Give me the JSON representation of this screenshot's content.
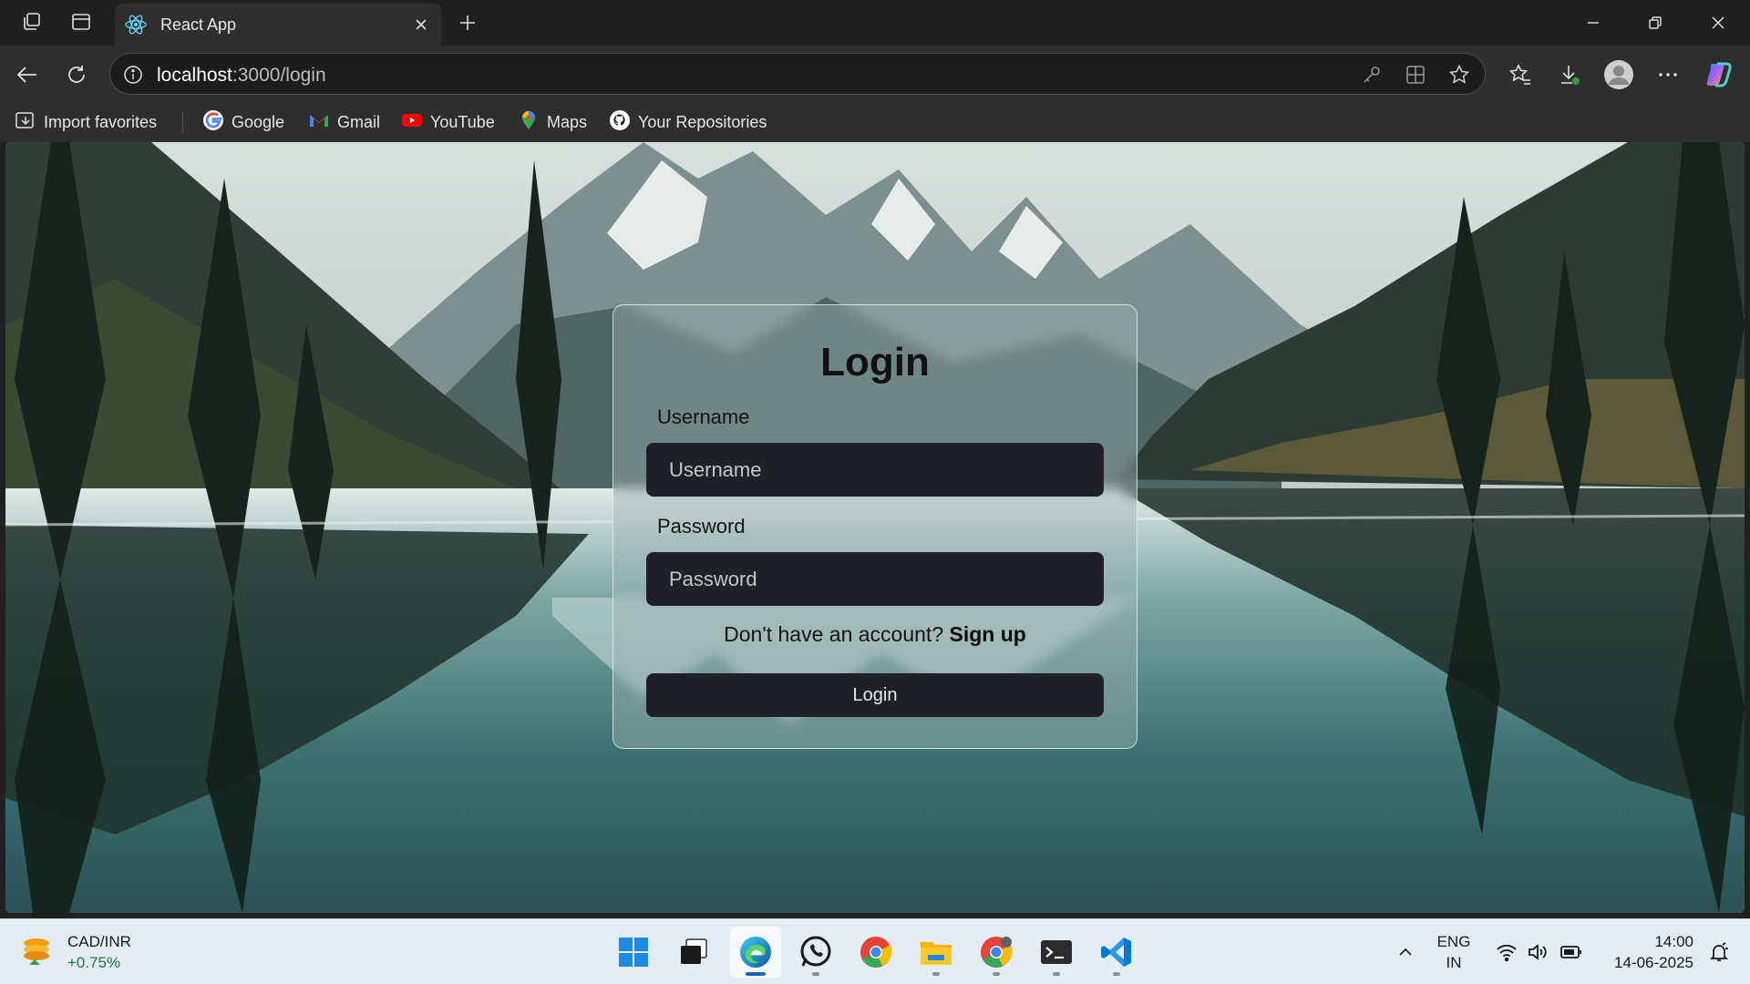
{
  "browser": {
    "tab_title": "React App",
    "url_host": "localhost",
    "url_path": ":3000/login"
  },
  "bookmarks": [
    {
      "label": "Import favorites",
      "icon": "import-favorites-icon"
    },
    {
      "label": "Google",
      "icon": "google-icon"
    },
    {
      "label": "Gmail",
      "icon": "gmail-icon"
    },
    {
      "label": "YouTube",
      "icon": "youtube-icon"
    },
    {
      "label": "Maps",
      "icon": "maps-icon"
    },
    {
      "label": "Your Repositories",
      "icon": "github-icon"
    }
  ],
  "login": {
    "title": "Login",
    "username_label": "Username",
    "username_placeholder": "Username",
    "password_label": "Password",
    "password_placeholder": "Password",
    "signup_prompt": "Don't have an account?",
    "signup_link": "Sign up",
    "submit_label": "Login"
  },
  "taskbar": {
    "widget": {
      "title": "CAD/INR",
      "change": "+0.75%"
    },
    "apps": [
      "start",
      "task-view",
      "edge",
      "whatsapp",
      "chrome",
      "file-explorer",
      "chrome-profile",
      "terminal",
      "vscode"
    ],
    "language": {
      "line1": "ENG",
      "line2": "IN"
    },
    "time": "14:00",
    "date": "14-06-2025"
  },
  "colors": {
    "chrome_dark": "#202020",
    "tab_active": "#2e2e2e",
    "input_bg": "#1e2126",
    "taskbar_bg": "#e4ecf6",
    "accent_blue": "#1565c0"
  }
}
